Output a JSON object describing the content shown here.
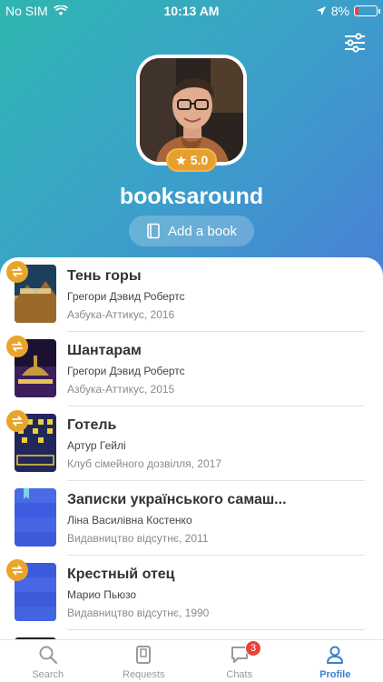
{
  "status_bar": {
    "carrier": "No SIM",
    "time": "10:13 AM",
    "battery": "8%"
  },
  "profile": {
    "rating": "5.0",
    "username": "booksaround",
    "add_book_label": "Add a book"
  },
  "books": [
    {
      "title": "Тень горы",
      "author": "Грегори Дэвид Робертс",
      "publisher": "Азбука-Аттикус, 2016",
      "swap": true
    },
    {
      "title": "Шантарам",
      "author": "Грегори Дэвид Робертс",
      "publisher": "Азбука-Аттикус, 2015",
      "swap": true
    },
    {
      "title": "Готель",
      "author": "Артур Гейлі",
      "publisher": "Клуб сімейного дозвілля, 2017",
      "swap": true
    },
    {
      "title": "Записки українського самаш...",
      "author": "Ліна Василівна Костенко",
      "publisher": "Видавництво відсутнє, 2011",
      "swap": false
    },
    {
      "title": "Крестный отец",
      "author": "Марио Пьюзо",
      "publisher": "Видавництво відсутнє, 1990",
      "swap": true
    }
  ],
  "tabs": [
    {
      "label": "Search",
      "icon": "search-icon"
    },
    {
      "label": "Requests",
      "icon": "requests-icon"
    },
    {
      "label": "Chats",
      "icon": "chat-icon",
      "badge": "3"
    },
    {
      "label": "Profile",
      "icon": "profile-icon",
      "active": true
    }
  ],
  "colors": {
    "accent": "#3a7fd0",
    "swap_badge": "#e9a52b",
    "notification": "#e8423b"
  }
}
